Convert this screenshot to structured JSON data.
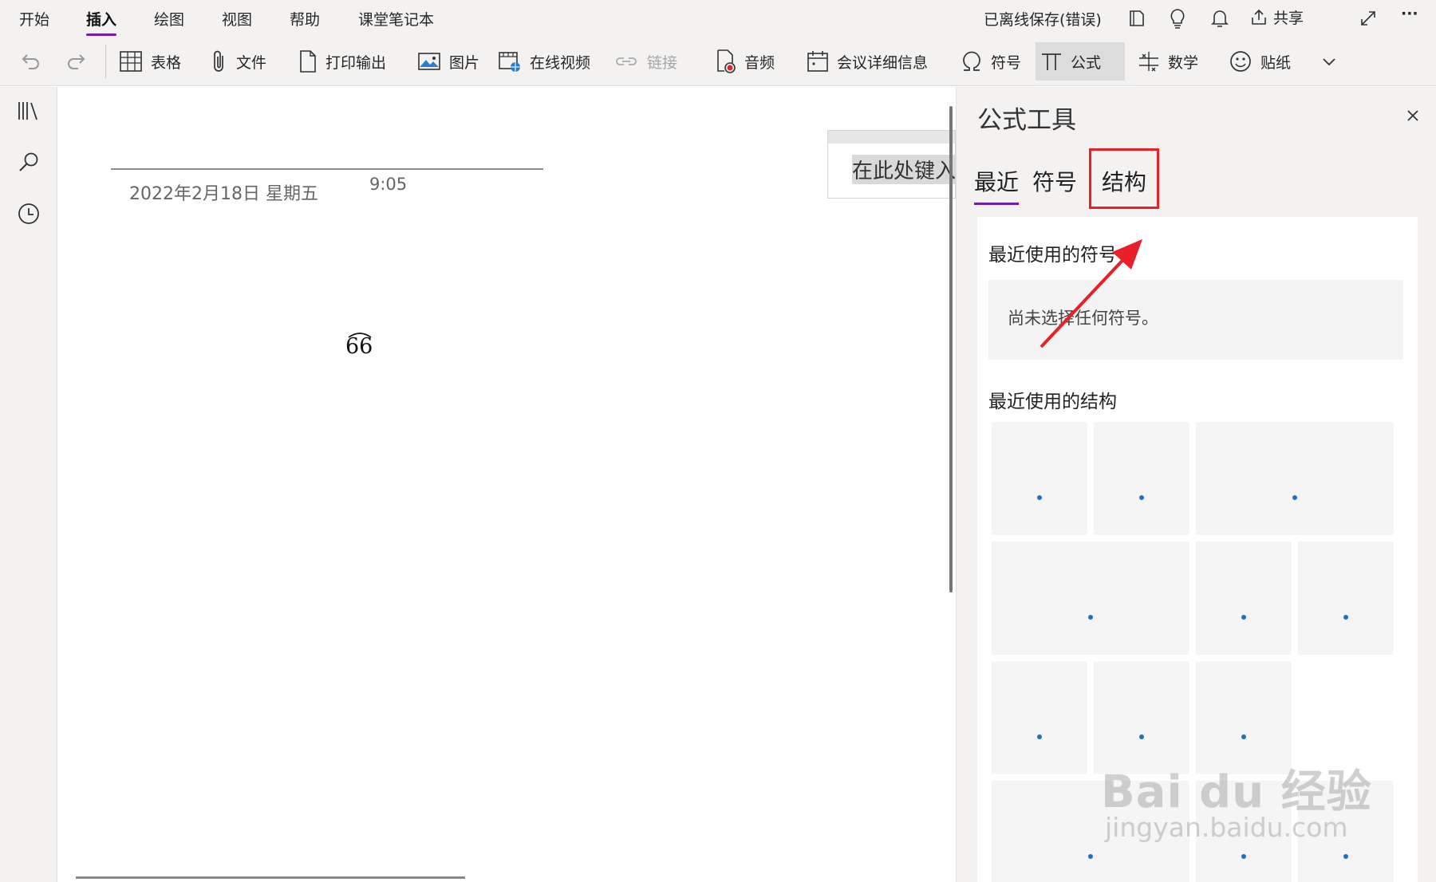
{
  "menu": {
    "tabs": [
      "开始",
      "插入",
      "绘图",
      "视图",
      "帮助",
      "课堂笔记本"
    ],
    "active_tab": "插入",
    "save_status": "已离线保存(错误)",
    "share_label": "共享",
    "more_label": "···"
  },
  "toolbar": {
    "table": "表格",
    "file": "文件",
    "printout": "打印输出",
    "picture": "图片",
    "online_video": "在线视频",
    "link": "链接",
    "audio": "音频",
    "meeting": "会议详细信息",
    "symbol": "符号",
    "equation": "公式",
    "math": "数学",
    "sticker": "贴纸"
  },
  "page": {
    "date": "2022年2月18日 星期五",
    "time": "9:05",
    "equation_text": "66",
    "input_placeholder": "在此处键入"
  },
  "pane": {
    "title": "公式工具",
    "tabs": [
      "最近",
      "符号",
      "结构"
    ],
    "active_tab": "最近",
    "highlighted_tab": "结构",
    "recent_symbols_title": "最近使用的符号",
    "no_symbols_text": "尚未选择任何符号。",
    "recent_structures_title": "最近使用的结构"
  },
  "watermark": {
    "main": "Bai du 经验",
    "sub": "jingyan.baidu.com"
  },
  "colors": {
    "accent": "#7719aa",
    "highlight": "#e8202a",
    "dot": "#1e6fc9"
  }
}
